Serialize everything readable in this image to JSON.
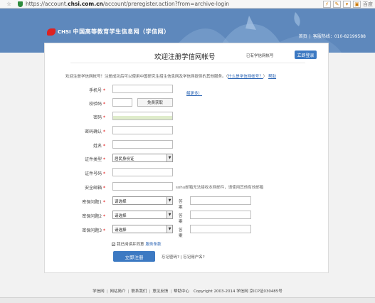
{
  "browser": {
    "url_prefix": "https://account.",
    "url_domain": "chsi.com.cn",
    "url_rest": "/account/preregister.action?from=archive-login",
    "search_placeholder": "百度"
  },
  "header": {
    "logo_chsi": "CHSI",
    "site_name": "中国高等教育学生信息网（学信网）",
    "home_link": "首页",
    "hotline": "客服热线：010-82199588"
  },
  "form": {
    "title": "欢迎注册学信网帐号",
    "has_account": "已有学信网帐号",
    "login_label": "立即登录",
    "intro_text": "欢迎注册学信网帐号！注册成功后可以使用中国研究生招生信息网及学信网提供的其他服务。（",
    "intro_link": "什么是学信网帐号？",
    "intro_end": "）",
    "help_link": "帮助",
    "more_link": "解更多）",
    "fields": {
      "mobile": "手机号",
      "verify_code": "校验码",
      "get_code": "免费获取",
      "password": "密码",
      "password_confirm": "密码确认",
      "name": "姓名",
      "id_type": "证件类型",
      "id_type_value": "居民身份证",
      "id_number": "证件号码",
      "email": "安全邮箱",
      "email_hint": "sohu邮箱无法接收本网邮件，请使用其他有效邮箱",
      "question1": "密保问题1",
      "question2": "密保问题2",
      "question3": "密保问题3",
      "select_placeholder": "请选择",
      "answer": "答案"
    },
    "agree_text": "我已阅读并同意",
    "agree_link": "服务条款",
    "submit_label": "立即注册",
    "forgot_password": "忘记密码?",
    "forgot_username": "忘记用户名?"
  },
  "footer": {
    "links": [
      "学信网",
      "网站简介",
      "联系我们",
      "意见反馈",
      "帮助中心"
    ],
    "copyright": "Copyright 2003-2014 学信网 京ICP证030485号"
  }
}
